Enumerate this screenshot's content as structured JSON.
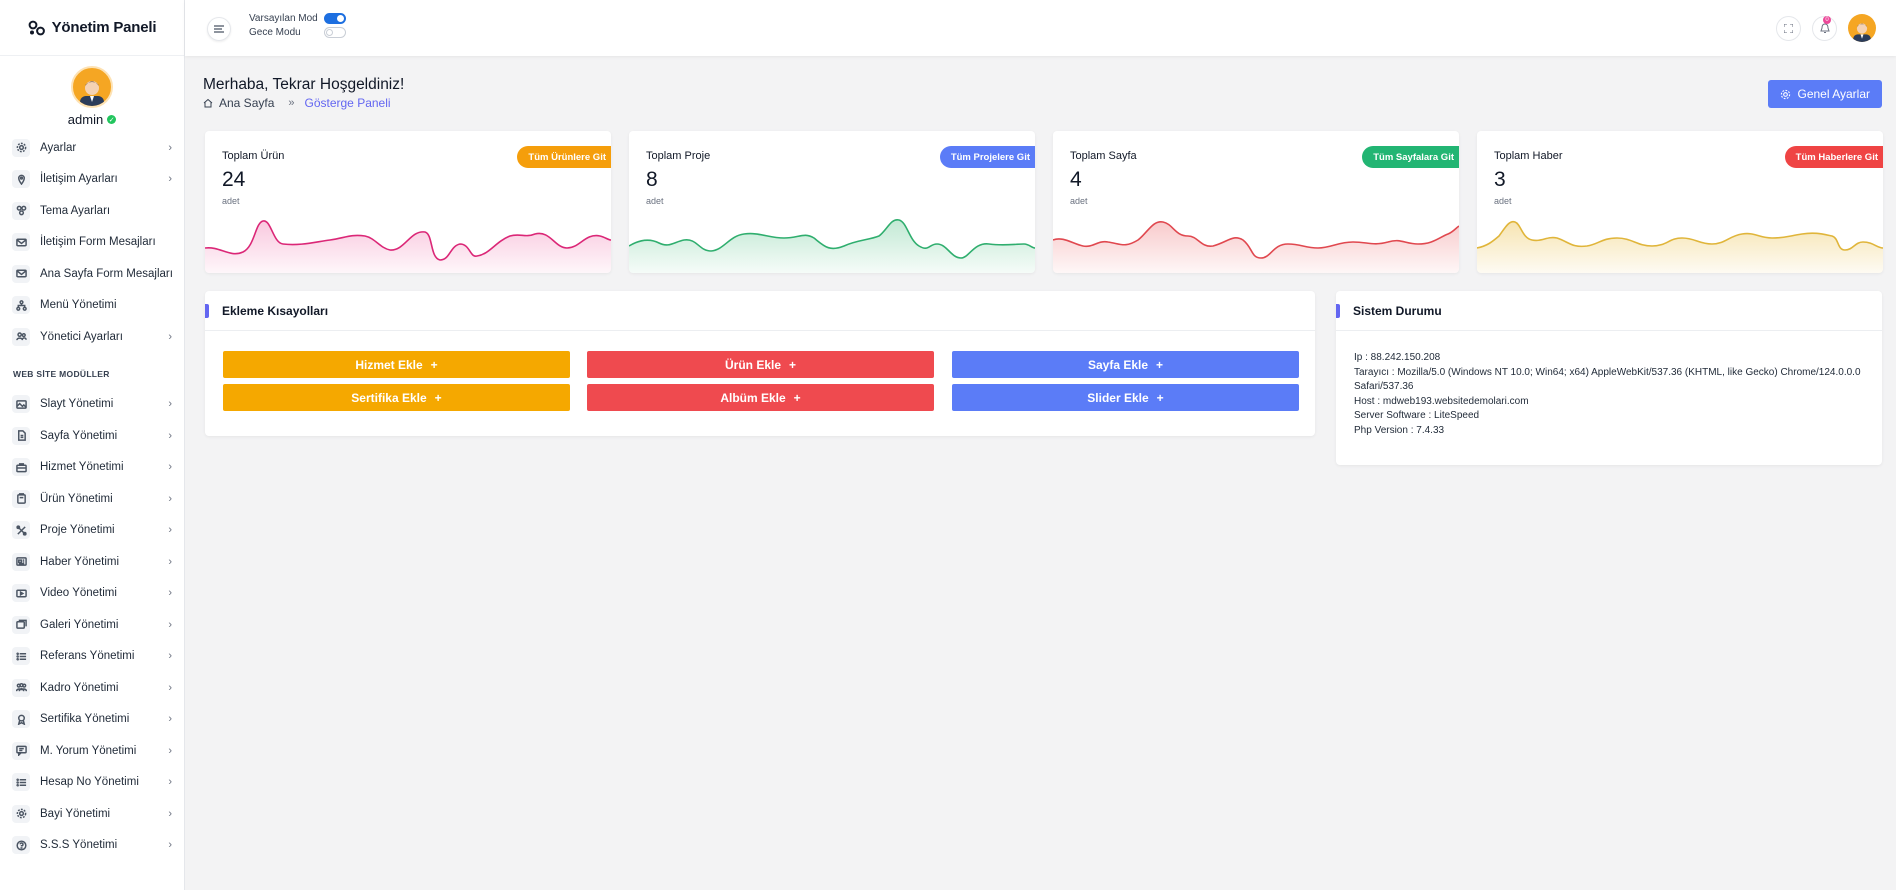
{
  "brand": {
    "title": "Yönetim Paneli"
  },
  "profile": {
    "name": "admin"
  },
  "sidebar": {
    "items": [
      {
        "label": "Ayarlar",
        "icon": "gear-icon",
        "chevron": true
      },
      {
        "label": "İletişim Ayarları",
        "icon": "map-pin-icon",
        "chevron": true
      },
      {
        "label": "Tema Ayarları",
        "icon": "palette-icon",
        "chevron": false
      },
      {
        "label": "İletişim Form Mesajları",
        "icon": "mail-icon",
        "chevron": false
      },
      {
        "label": "Ana Sayfa Form Mesajları",
        "icon": "mail-icon",
        "chevron": false
      },
      {
        "label": "Menü Yönetimi",
        "icon": "menu-tree-icon",
        "chevron": false
      },
      {
        "label": "Yönetici Ayarları",
        "icon": "users-icon",
        "chevron": true
      }
    ],
    "section_title": "WEB SİTE MODÜLLER",
    "modules": [
      {
        "label": "Slayt Yönetimi",
        "icon": "image-icon"
      },
      {
        "label": "Sayfa Yönetimi",
        "icon": "file-icon"
      },
      {
        "label": "Hizmet Yönetimi",
        "icon": "briefcase-icon"
      },
      {
        "label": "Ürün Yönetimi",
        "icon": "clipboard-icon"
      },
      {
        "label": "Proje Yönetimi",
        "icon": "tools-icon"
      },
      {
        "label": "Haber Yönetimi",
        "icon": "newspaper-icon"
      },
      {
        "label": "Video Yönetimi",
        "icon": "video-icon"
      },
      {
        "label": "Galeri Yönetimi",
        "icon": "gallery-icon"
      },
      {
        "label": "Referans Yönetimi",
        "icon": "list-icon"
      },
      {
        "label": "Kadro Yönetimi",
        "icon": "team-icon"
      },
      {
        "label": "Sertifika Yönetimi",
        "icon": "award-icon"
      },
      {
        "label": "M. Yorum Yönetimi",
        "icon": "comment-icon"
      },
      {
        "label": "Hesap No Yönetimi",
        "icon": "list-icon"
      },
      {
        "label": "Bayi Yönetimi",
        "icon": "gear-icon"
      },
      {
        "label": "S.S.S Yönetimi",
        "icon": "help-circle-icon"
      }
    ]
  },
  "topbar": {
    "default_mode_label": "Varsayılan Mod",
    "default_mode_on": true,
    "night_mode_label": "Gece Modu",
    "night_mode_on": false,
    "notification_count": "0"
  },
  "page": {
    "title": "Merhaba, Tekrar Hoşgeldiniz!",
    "breadcrumb_home": "Ana Sayfa",
    "breadcrumb_current": "Gösterge Paneli",
    "settings_button": "Genel Ayarlar"
  },
  "stats": [
    {
      "title": "Toplam Ürün",
      "value": "24",
      "unit": "adet",
      "link": "Tüm Ürünlere Git",
      "color": "#f59e0b",
      "line": "#db2777",
      "fill": "#f9c6dd"
    },
    {
      "title": "Toplam Proje",
      "value": "8",
      "unit": "adet",
      "link": "Tüm Projelere Git",
      "color": "#5b7cf7",
      "line": "#2fae6e",
      "fill": "#bfe8d2"
    },
    {
      "title": "Toplam Sayfa",
      "value": "4",
      "unit": "adet",
      "link": "Tüm Sayfalara Git",
      "color": "#22b573",
      "line": "#e0484f",
      "fill": "#f8c8c9"
    },
    {
      "title": "Toplam Haber",
      "value": "3",
      "unit": "adet",
      "link": "Tüm Haberlere Git",
      "color": "#ef4444",
      "line": "#e0b53a",
      "fill": "#f6e3ae"
    }
  ],
  "shortcuts": {
    "title": "Ekleme Kısayolları",
    "buttons": [
      {
        "label": "Hizmet Ekle",
        "color": "#f5a800"
      },
      {
        "label": "Ürün Ekle",
        "color": "#ef4a4f"
      },
      {
        "label": "Sayfa Ekle",
        "color": "#5b7cf7"
      },
      {
        "label": "Sertifika Ekle",
        "color": "#f5a800"
      },
      {
        "label": "Albüm Ekle",
        "color": "#ef4a4f"
      },
      {
        "label": "Slider Ekle",
        "color": "#5b7cf7"
      }
    ]
  },
  "system": {
    "title": "Sistem Durumu",
    "lines": [
      "Ip : 88.242.150.208",
      "Tarayıcı : Mozilla/5.0 (Windows NT 10.0; Win64; x64) AppleWebKit/537.36 (KHTML, like Gecko) Chrome/124.0.0.0 Safari/537.36",
      "Host : mdweb193.websitedemolari.com",
      "Server Software : LiteSpeed",
      "Php Version : 7.4.33"
    ]
  }
}
